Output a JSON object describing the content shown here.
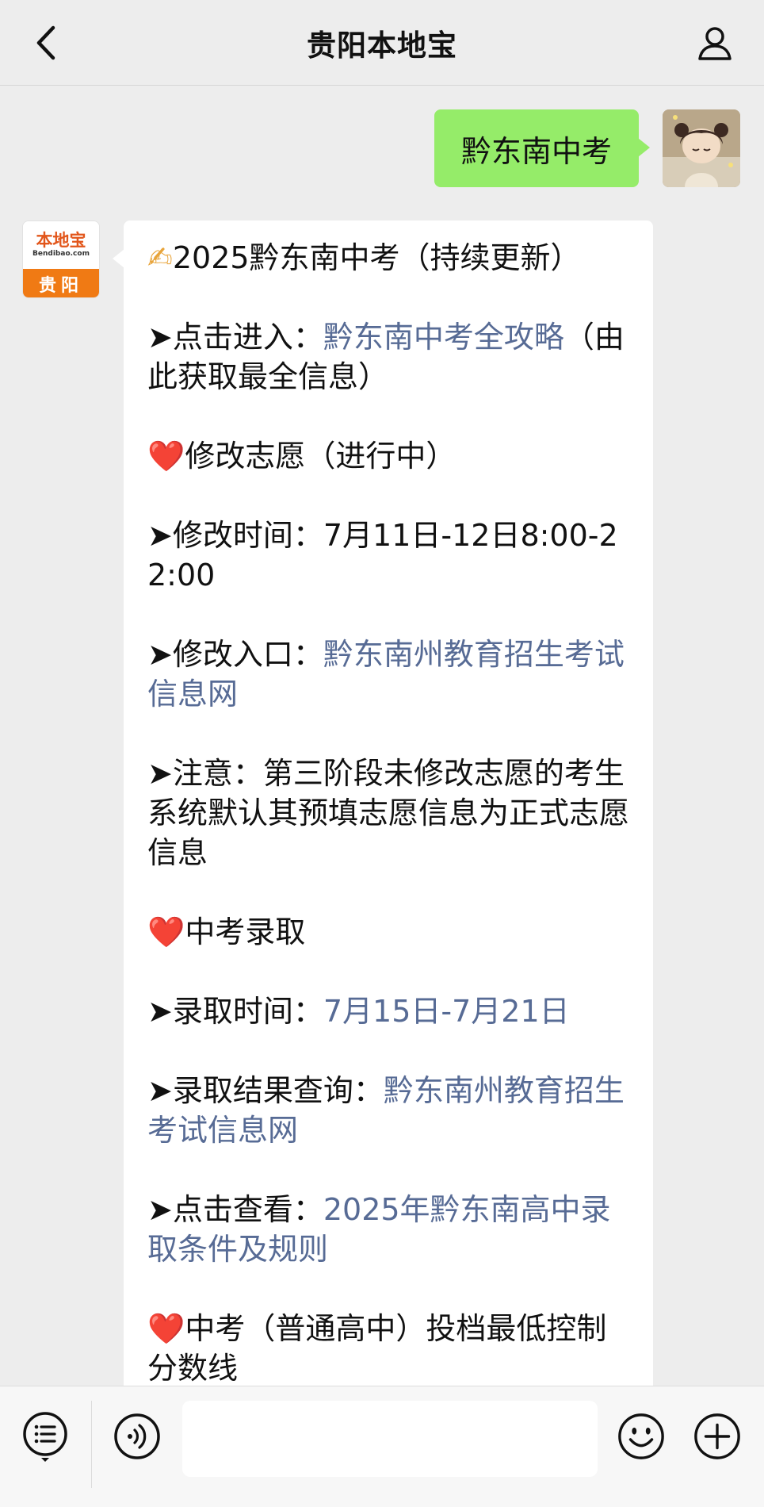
{
  "header": {
    "title": "贵阳本地宝",
    "back_icon": "chevron-left-icon",
    "profile_icon": "person-icon"
  },
  "outgoing": {
    "text": "黔东南中考"
  },
  "bot": {
    "logo_cn": "本地宝",
    "logo_en": "Bendibao.com",
    "logo_city": "贵阳"
  },
  "message": {
    "title_emoji": "✍",
    "title": "2025黔东南中考（持续更新）",
    "entry_label": "➤点击进入：",
    "entry_link": "黔东南中考全攻略",
    "entry_suffix": "（由此获取最全信息）",
    "heart": "❤️",
    "section1": "修改志愿（进行中）",
    "modify_time_label": "➤修改时间：",
    "modify_time_value": "7月11日-12日8:00-22:00",
    "modify_entry_label": "➤修改入口：",
    "modify_entry_link": "黔东南州教育招生考试信息网",
    "note_label": "➤注意：",
    "note_text": "第三阶段未修改志愿的考生系统默认其预填志愿信息为正式志愿信息",
    "section2": "中考录取",
    "admit_time_label": "➤录取时间：",
    "admit_time_link": "7月15日-7月21日",
    "admit_result_label": "➤录取结果查询：",
    "admit_result_link": "黔东南州教育招生考试信息网",
    "view_label": "➤点击查看：",
    "view_link": "2025年黔东南高中录取条件及规则",
    "section3": "中考（普通高中）投档最低控制分数线"
  },
  "toolbar": {
    "menu_icon": "list-menu-icon",
    "voice_icon": "voice-icon",
    "emoji_icon": "emoji-icon",
    "plus_icon": "plus-icon",
    "input_value": ""
  }
}
